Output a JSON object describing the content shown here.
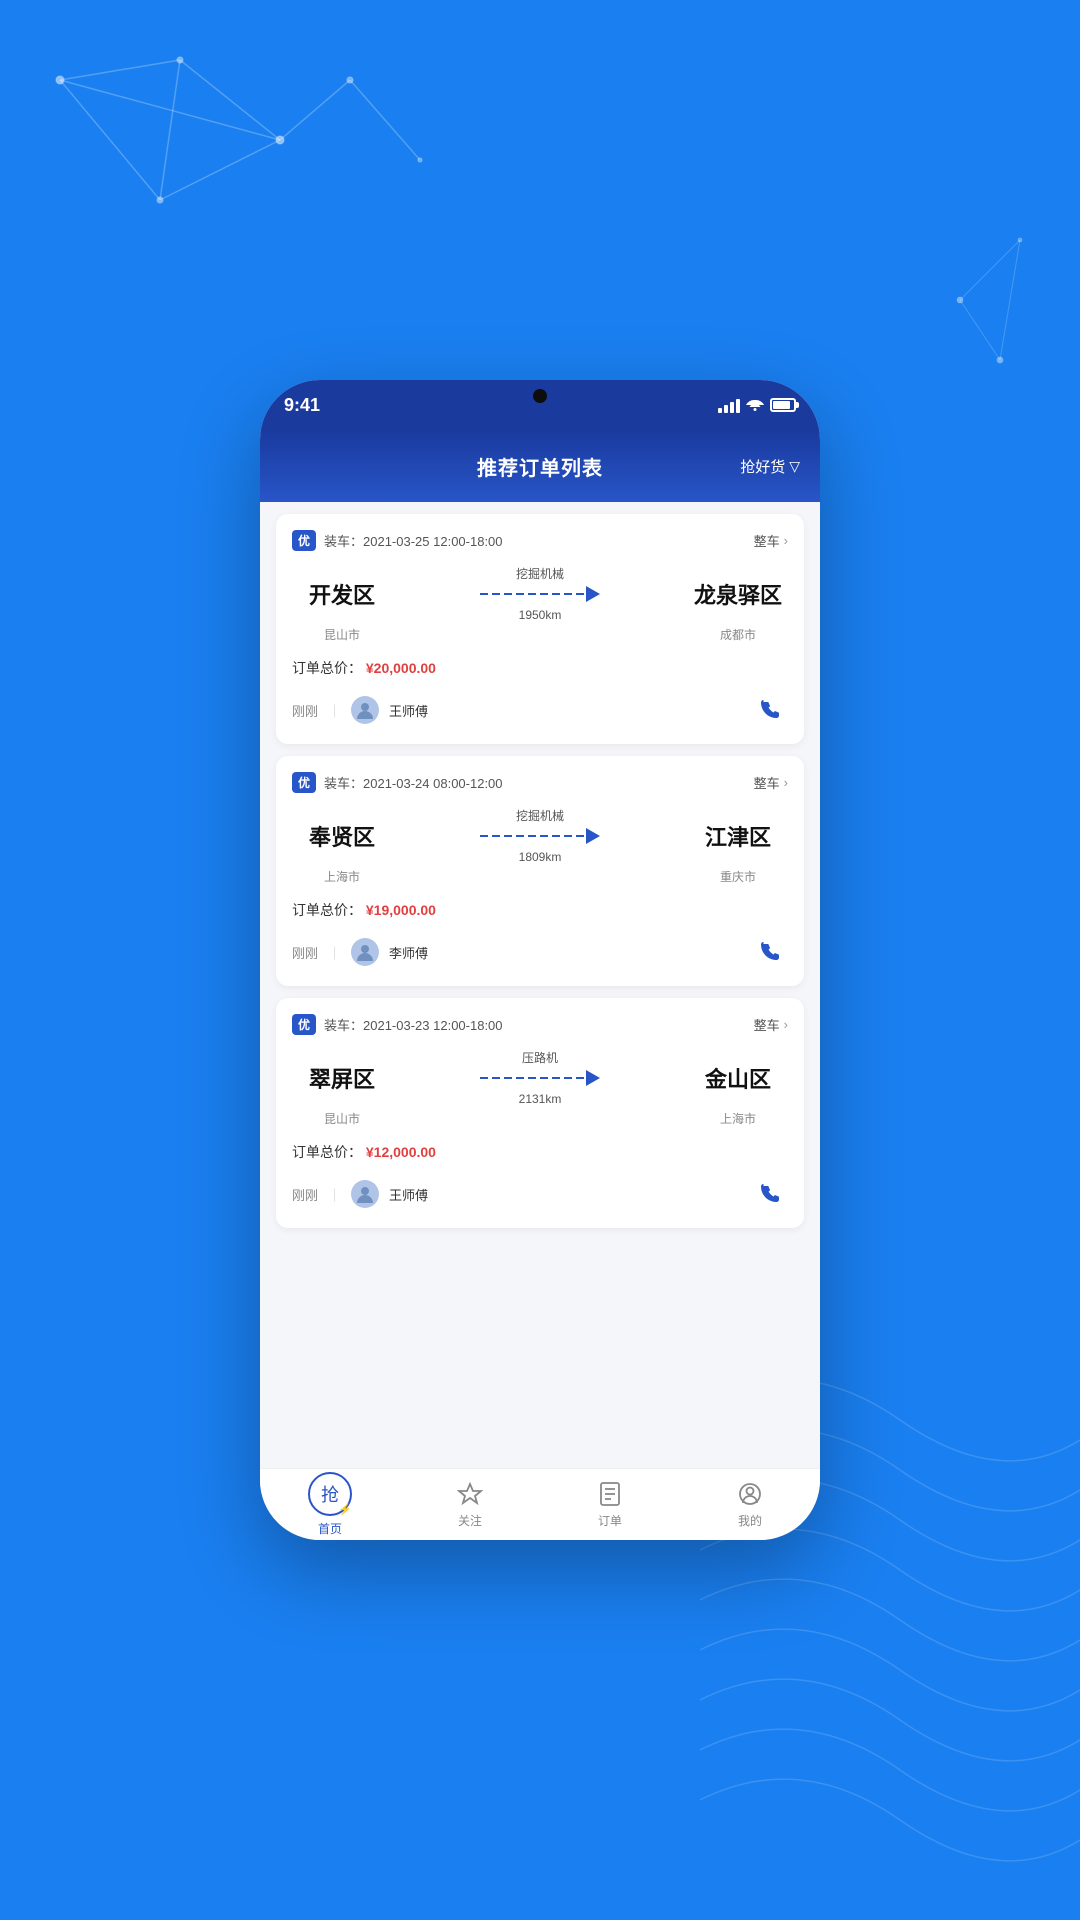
{
  "background_color": "#1a7ff0",
  "status_bar": {
    "time": "9:41",
    "battery_level": 85
  },
  "header": {
    "title": "推荐订单列表",
    "filter_label": "抢好货"
  },
  "orders": [
    {
      "badge": "优",
      "date": "装车：2021-03-25 12:00-18:00",
      "type": "整车",
      "from_city": "开发区",
      "from_sub": "昆山市",
      "to_city": "龙泉驿区",
      "to_sub": "成都市",
      "cargo": "挖掘机械",
      "distance": "1950km",
      "price_label": "订单总价：",
      "price": "¥20,000.00",
      "time_ago": "刚刚",
      "driver_name": "王师傅"
    },
    {
      "badge": "优",
      "date": "装车：2021-03-24 08:00-12:00",
      "type": "整车",
      "from_city": "奉贤区",
      "from_sub": "上海市",
      "to_city": "江津区",
      "to_sub": "重庆市",
      "cargo": "挖掘机械",
      "distance": "1809km",
      "price_label": "订单总价：",
      "price": "¥19,000.00",
      "time_ago": "刚刚",
      "driver_name": "李师傅"
    },
    {
      "badge": "优",
      "date": "装车：2021-03-23 12:00-18:00",
      "type": "整车",
      "from_city": "翠屏区",
      "from_sub": "昆山市",
      "to_city": "金山区",
      "to_sub": "上海市",
      "cargo": "压路机",
      "distance": "2131km",
      "price_label": "订单总价：",
      "price": "¥12,000.00",
      "time_ago": "刚刚",
      "driver_name": "王师傅"
    }
  ],
  "bottom_nav": [
    {
      "id": "home",
      "label": "首页",
      "active": true
    },
    {
      "id": "follow",
      "label": "关注",
      "active": false
    },
    {
      "id": "order",
      "label": "订单",
      "active": false
    },
    {
      "id": "mine",
      "label": "我的",
      "active": false
    }
  ]
}
